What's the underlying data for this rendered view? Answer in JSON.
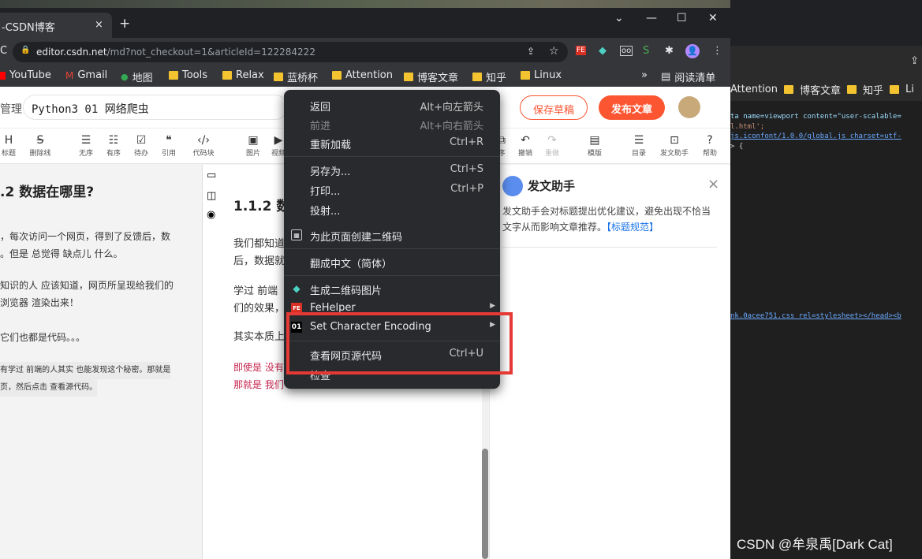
{
  "browser": {
    "tab_title": "-CSDN博客",
    "tab_close": "×",
    "new_tab": "+",
    "url_host": "editor.csdn.net",
    "url_path": "/md?not_checkout=1&articleId=122284222",
    "reload": "C",
    "lock": "🔒",
    "controls": {
      "dropdown": "⌄",
      "minimize": "—",
      "maximize": "☐",
      "close": "✕"
    },
    "toolbar_icons": {
      "share": "⇪",
      "star": "☆",
      "fe": "FE",
      "diamond": "◆",
      "ext1": "oo",
      "ext2": "S",
      "puzzle": "✱",
      "profile": "👤",
      "more": "⋮"
    }
  },
  "bookmarks": {
    "items": [
      {
        "label": "YouTube"
      },
      {
        "label": "Gmail"
      },
      {
        "label": "地图"
      },
      {
        "label": "Tools"
      },
      {
        "label": "Relax"
      },
      {
        "label": "蓝桥杯"
      },
      {
        "label": "Attention"
      },
      {
        "label": "博客文章"
      },
      {
        "label": "知乎"
      },
      {
        "label": "Linux"
      }
    ],
    "overflow": "»",
    "reading_list": "阅读清单"
  },
  "editor": {
    "manage_label": "管理",
    "title_value": "Python3 01 网络爬虫",
    "save_label": "保存草稿",
    "publish_label": "发布文章",
    "toolbar": [
      {
        "g": "H",
        "t": "标题"
      },
      {
        "g": "S",
        "t": "删除线"
      },
      {
        "g": "☰",
        "t": "无序"
      },
      {
        "g": "☷",
        "t": "有序"
      },
      {
        "g": "☑",
        "t": "待办"
      },
      {
        "g": "❝",
        "t": "引用"
      },
      {
        "g": "‹/›",
        "t": "代码块"
      },
      {
        "g": "▣",
        "t": "图片"
      },
      {
        "g": "▶",
        "t": "视频"
      }
    ],
    "toolbar_right": [
      {
        "g": "⧉",
        "t": "序"
      },
      {
        "g": "↶",
        "t": "撤销"
      },
      {
        "g": "↷",
        "t": "重做"
      },
      {
        "g": "▤",
        "t": "模版"
      },
      {
        "g": "☰",
        "t": "目录"
      },
      {
        "g": "⊡",
        "t": "发文助手"
      },
      {
        "g": "?",
        "t": "帮助"
      }
    ]
  },
  "left_pane": {
    "heading": ".2 数据在哪里?",
    "lines": [
      "，每次访问一个网页，得到了反馈后，数",
      "。但是 总觉得 缺点儿 什么。",
      "知识的人 应该知道，网页所呈现给我们的",
      "浏览器 渲染出来！",
      "它们也都是代码。。。",
      "有学过 前端的人其实 也能发现这个秘密。那就是",
      "页，然后点击 查看源代码。"
    ]
  },
  "preview": {
    "heading": "1.1.2 数",
    "lines": [
      "我们都知道",
      "后，数据就",
      "学过 前端",
      "们的效果，",
      "其实本质上"
    ],
    "red": [
      "即使是 没有",
      "那就是 我们"
    ]
  },
  "assistant": {
    "title": "发文助手",
    "close": "×",
    "text1": "发文助手会对标题提出优化建议，避免出现不恰当",
    "text2": "文字从而影响文章推荐。",
    "link": "【标题规范】"
  },
  "context_menu": {
    "items": [
      {
        "label": "返回",
        "shortcut": "Alt+向左箭头"
      },
      {
        "label": "前进",
        "shortcut": "Alt+向右箭头"
      },
      {
        "label": "重新加载",
        "shortcut": "Ctrl+R"
      },
      {
        "label": "另存为...",
        "shortcut": "Ctrl+S"
      },
      {
        "label": "打印...",
        "shortcut": "Ctrl+P"
      },
      {
        "label": "投射..."
      },
      {
        "label": "为此页面创建二维码"
      },
      {
        "label": "翻成中文（简体）"
      },
      {
        "label": "生成二维码图片"
      },
      {
        "label": "FeHelper"
      },
      {
        "label": "Set Character Encoding"
      },
      {
        "label": "查看网页源代码",
        "shortcut": "Ctrl+U"
      },
      {
        "label": "检查"
      }
    ]
  },
  "right_window": {
    "bookmarks": [
      "Attention",
      "博客文章",
      "知乎",
      "Li"
    ],
    "code": [
      "ta name=viewport content=\"user-scalable=",
      "l.html';",
      "js.iconfont/1.0.0/global.js charset=utf-",
      "> {",
      "nk.0acee751.css rel=stylesheet></head><b"
    ]
  },
  "watermark": "CSDN @牟泉禹[Dark Cat]",
  "colors": {
    "accent": "#fc5531",
    "highlight": "#e53935",
    "menu_bg": "#292a2d"
  }
}
